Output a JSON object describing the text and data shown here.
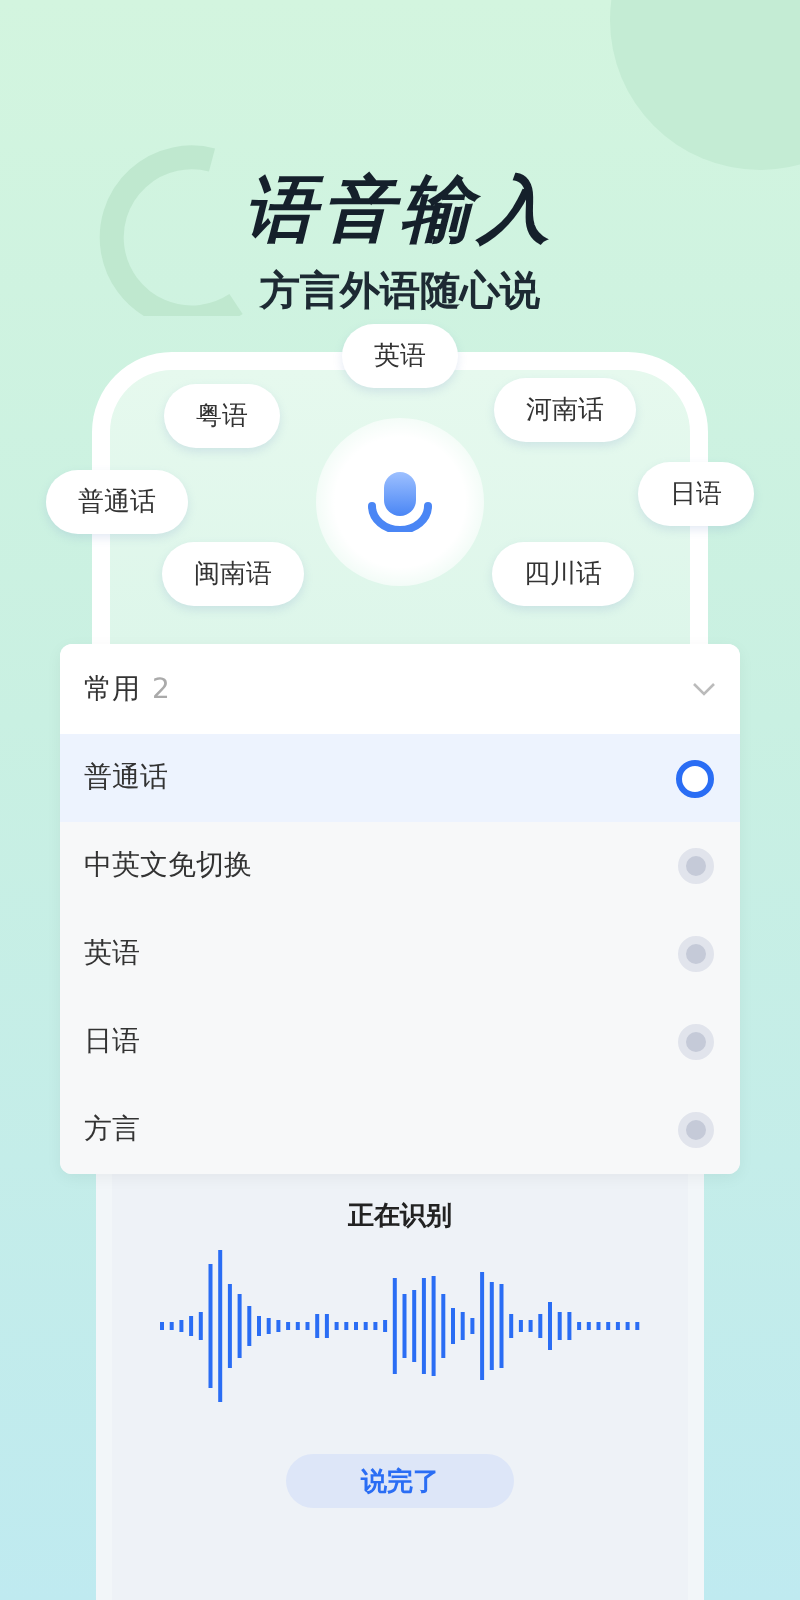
{
  "title": "语音输入",
  "subtitle": "方言外语随心说",
  "language_chips": [
    "英语",
    "粤语",
    "河南话",
    "普通话",
    "日语",
    "闽南语",
    "四川话"
  ],
  "language_menu": {
    "label": "常用",
    "count": "2",
    "options": [
      {
        "label": "普通话",
        "selected": true
      },
      {
        "label": "中英文免切换",
        "selected": false
      },
      {
        "label": "英语",
        "selected": false
      },
      {
        "label": "日语",
        "selected": false
      },
      {
        "label": "方言",
        "selected": false
      }
    ]
  },
  "status": "正在识别",
  "done_button": "说完了"
}
